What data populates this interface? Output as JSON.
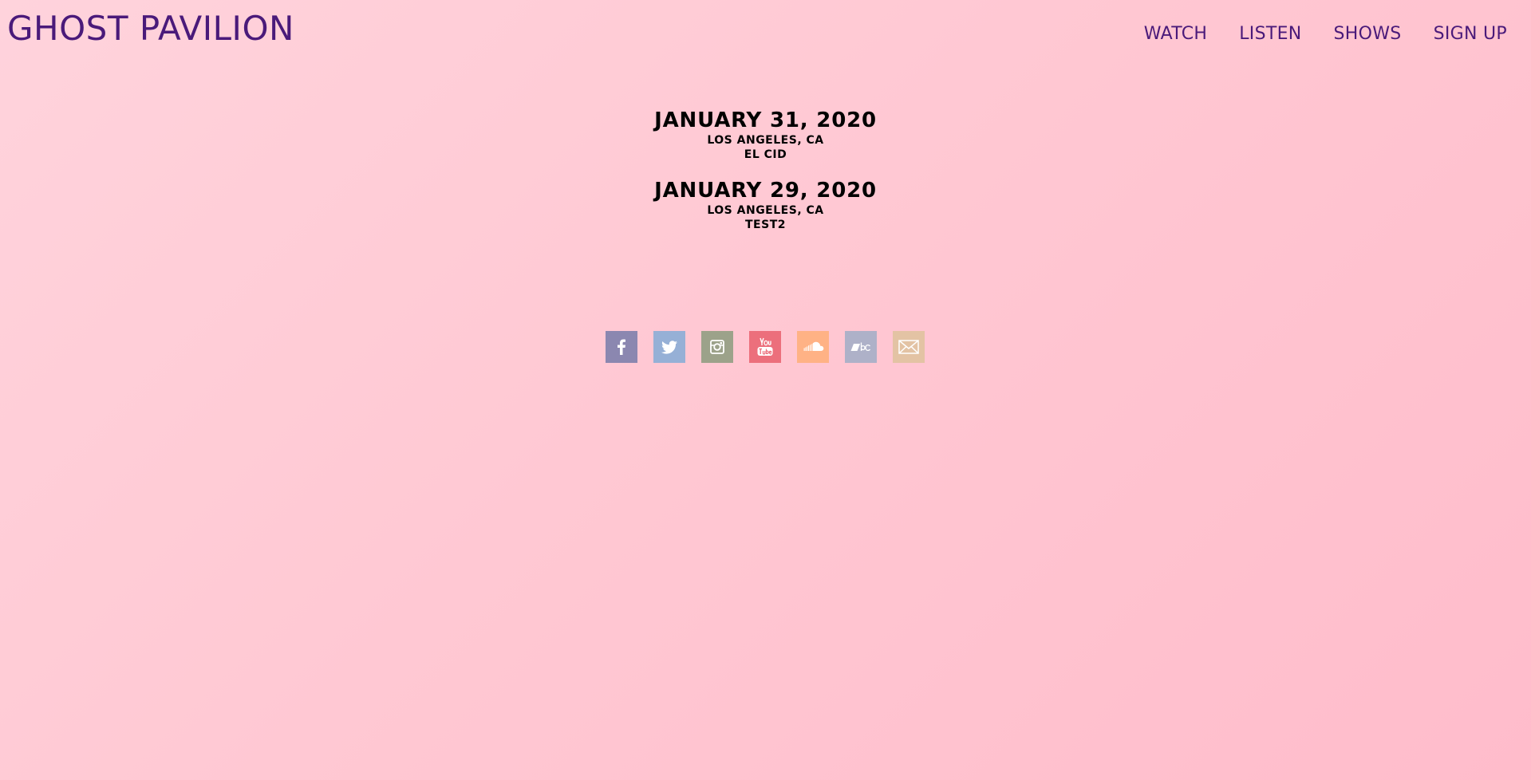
{
  "header": {
    "site_title": "GHOST PAVILION",
    "nav": [
      {
        "label": "WATCH"
      },
      {
        "label": "LISTEN"
      },
      {
        "label": "SHOWS"
      },
      {
        "label": "SIGN UP"
      }
    ]
  },
  "shows": [
    {
      "date": "JANUARY 31, 2020",
      "city": "LOS ANGELES, CA",
      "venue": "EL CID"
    },
    {
      "date": "JANUARY 29, 2020",
      "city": "LOS ANGELES, CA",
      "venue": "TEST2"
    }
  ],
  "social": [
    {
      "icon": "facebook-icon",
      "color": "#8b87b0"
    },
    {
      "icon": "twitter-icon",
      "color": "#96b0d6"
    },
    {
      "icon": "instagram-icon",
      "color": "#9ca28a"
    },
    {
      "icon": "youtube-icon",
      "color": "#ec6f7c"
    },
    {
      "icon": "soundcloud-icon",
      "color": "#ffb285"
    },
    {
      "icon": "bandcamp-icon",
      "color": "#aeb1c8"
    },
    {
      "icon": "email-icon",
      "color": "#e3c3a4"
    }
  ],
  "colors": {
    "brand": "#4a1a7a",
    "background_start": "#ffd3dc",
    "background_end": "#ffbccb"
  }
}
